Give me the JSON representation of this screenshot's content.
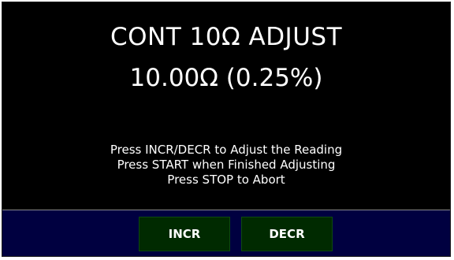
{
  "screen": {
    "title": "CONT 10Ω ADJUST",
    "reading": "10.00Ω (0.25%)",
    "instructions": [
      "Press INCR/DECR to Adjust the Reading",
      "Press START when Finished Adjusting",
      "Press STOP to Abort"
    ]
  },
  "buttons": {
    "incr_label": "INCR",
    "decr_label": "DECR"
  },
  "colors": {
    "background": "#000000",
    "text": "#ffffff",
    "button_bar": "#000040",
    "button": "#002a00"
  }
}
